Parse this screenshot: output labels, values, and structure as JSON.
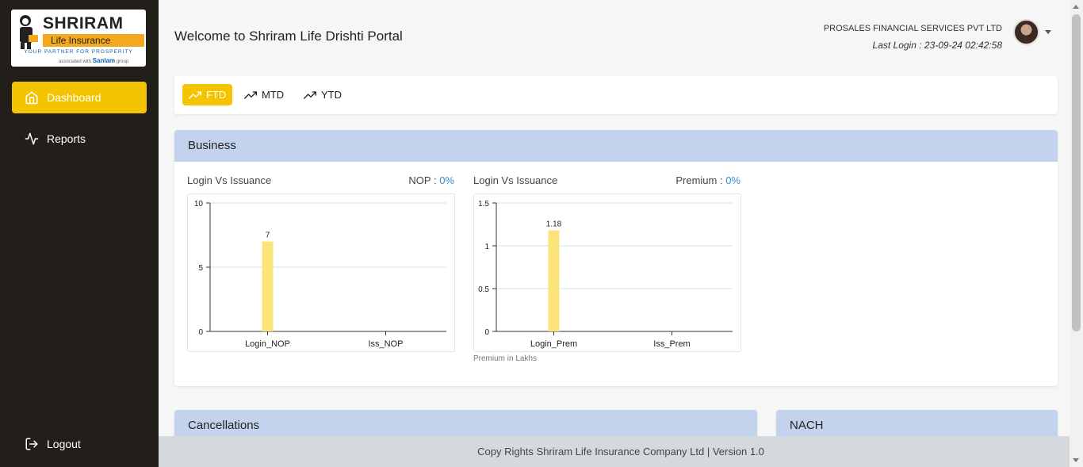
{
  "sidebar": {
    "logo": {
      "brand": "SHRIRAM",
      "sub": "Life Insurance",
      "tagline": "YOUR PARTNER FOR PROSPERITY",
      "assoc_prefix": "associated with",
      "assoc_brand": "Sanlam",
      "assoc_suffix": "group"
    },
    "items": [
      {
        "label": "Dashboard",
        "icon": "home-icon",
        "active": true
      },
      {
        "label": "Reports",
        "icon": "activity-icon",
        "active": false
      }
    ],
    "logout": {
      "label": "Logout",
      "icon": "logout-icon"
    }
  },
  "header": {
    "welcome": "Welcome to Shriram Life Drishti Portal",
    "org": "PROSALES FINANCIAL SERVICES PVT LTD",
    "last_login_label": "Last Login :",
    "last_login_value": "23-09-24 02:42:58"
  },
  "period_tabs": [
    {
      "label": "FTD",
      "icon": "trending-up-icon",
      "active": true
    },
    {
      "label": "MTD",
      "icon": "trending-up-icon",
      "active": false
    },
    {
      "label": "YTD",
      "icon": "trending-up-icon",
      "active": false
    }
  ],
  "business": {
    "title": "Business",
    "charts": [
      {
        "title": "Login Vs Issuance",
        "metric_label": "NOP :",
        "metric_value": "0%"
      },
      {
        "title": "Login Vs Issuance",
        "metric_label": "Premium :",
        "metric_value": "0%",
        "note": "Premium in Lakhs"
      }
    ]
  },
  "cancellations": {
    "title": "Cancellations"
  },
  "nach": {
    "title": "NACH"
  },
  "footer": {
    "text": "Copy Rights Shriram Life Insurance Company Ltd | Version 1.0"
  },
  "colors": {
    "accent": "#f5c400",
    "bar": "#fce47a",
    "card_head": "#c3d3ee",
    "pct": "#2f8fd8",
    "sidebar": "#221f1a"
  },
  "chart_data": [
    {
      "type": "bar",
      "categories": [
        "Login_NOP",
        "Iss_NOP"
      ],
      "values": [
        7,
        0
      ],
      "data_labels": [
        "7",
        ""
      ],
      "ylim": [
        0,
        10
      ],
      "yticks": [
        "0",
        "5",
        "10"
      ],
      "ytick_values": [
        0,
        5,
        10
      ],
      "grid": true
    },
    {
      "type": "bar",
      "categories": [
        "Login_Prem",
        "Iss_Prem"
      ],
      "values": [
        1.18,
        0
      ],
      "data_labels": [
        "1.18",
        ""
      ],
      "ylim": [
        0,
        1.5
      ],
      "yticks": [
        "0",
        "0.5",
        "1",
        "1.5"
      ],
      "ytick_values": [
        0,
        0.5,
        1,
        1.5
      ],
      "grid": true
    }
  ]
}
